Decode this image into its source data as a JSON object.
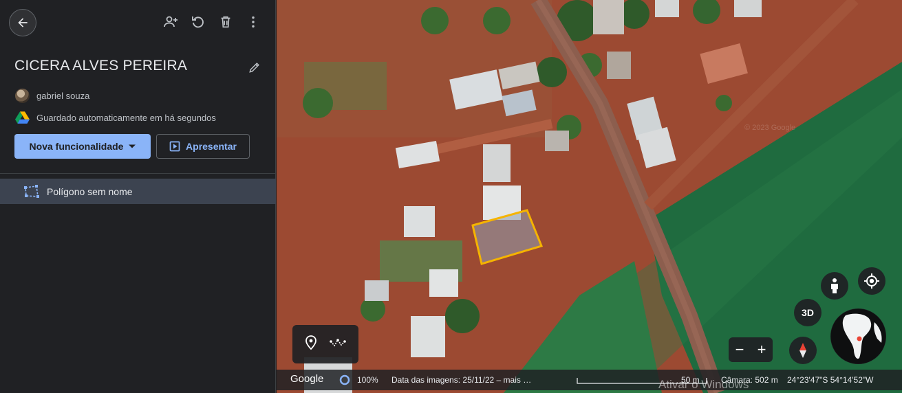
{
  "sidebar": {
    "project_title": "CICERA ALVES PEREIRA",
    "owner_name": "gabriel souza",
    "save_status": "Guardado automaticamente em há segundos",
    "new_feature_label": "Nova funcionalidade",
    "present_label": "Apresentar",
    "features": [
      {
        "label": "Polígono sem nome",
        "icon": "polygon-icon"
      }
    ],
    "icons": [
      "back-arrow-icon",
      "add-person-icon",
      "undo-icon",
      "trash-icon",
      "more-vert-icon",
      "edit-pencil-icon",
      "google-drive-icon"
    ]
  },
  "map": {
    "view_3d_label": "3D",
    "zoom_out_label": "−",
    "zoom_in_label": "+",
    "status": {
      "brand": "Google",
      "loading_percent": "100%",
      "imagery_date": "Data das imagens: 25/11/22 – mais …",
      "scale": "50 m",
      "camera": "Câmara: 502 m",
      "coords": "24°23'47\"S 54°14'52\"W"
    },
    "copyright_overlay": "© 2023 Google",
    "watermark": "Ativar o Windows"
  },
  "colors": {
    "accent": "#8ab4f8",
    "polygon_outline": "#f5b400",
    "sidebar_bg": "#202124",
    "selected_row_bg": "#3c4350"
  }
}
